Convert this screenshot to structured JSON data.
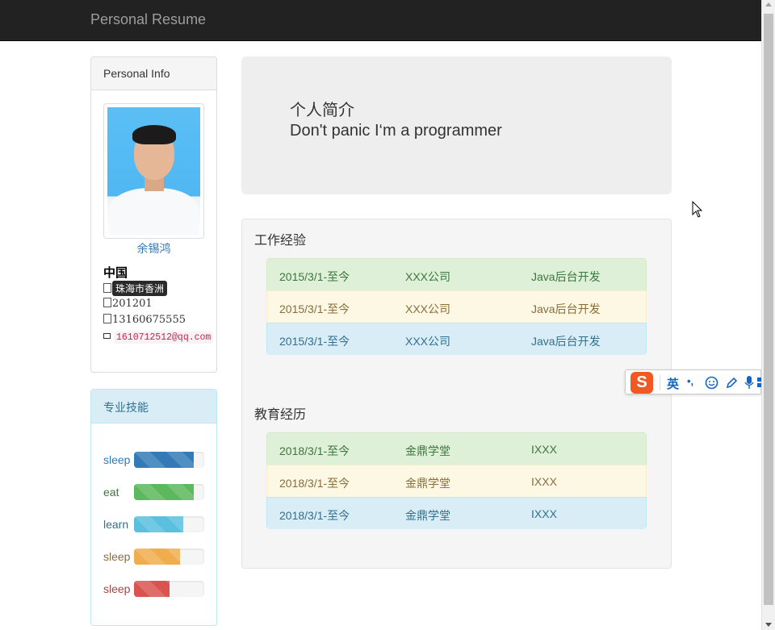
{
  "navbar": {
    "brand": "Personal Resume"
  },
  "personal": {
    "heading": "Personal Info",
    "name": "余锡鸿",
    "country": "中国",
    "address_tip": "珠海市香洲",
    "postal_code": "201201",
    "phone": "13160675555",
    "email": "1610712512@qq.com"
  },
  "skills": {
    "heading": "专业技能",
    "items": [
      {
        "label": "sleep",
        "level": 0.85,
        "color": "#337ab7",
        "label_color": "#337ab7"
      },
      {
        "label": "eat",
        "level": 0.85,
        "color": "#5cb85c",
        "label_color": "#3c763d"
      },
      {
        "label": "learn",
        "level": 0.7,
        "color": "#5bc0de",
        "label_color": "#31708f"
      },
      {
        "label": "sleep",
        "level": 0.65,
        "color": "#f0ad4e",
        "label_color": "#8a6d3b"
      },
      {
        "label": "sleep",
        "level": 0.5,
        "color": "#d9534f",
        "label_color": "#a94442"
      }
    ]
  },
  "intro": {
    "subtitle": "个人简介",
    "motto": "Don't panic I‘m a programmer"
  },
  "work": {
    "title": "工作经验",
    "rows": [
      {
        "date": "2015/3/1-至今",
        "org": "XXX公司",
        "role": "Java后台开发",
        "style": "success"
      },
      {
        "date": "2015/3/1-至今",
        "org": "XXX公司",
        "role": "Java后台开发",
        "style": "warning"
      },
      {
        "date": "2015/3/1-至今",
        "org": "XXX公司",
        "role": "Java后台开发",
        "style": "info"
      }
    ]
  },
  "education": {
    "title": "教育经历",
    "rows": [
      {
        "date": "2018/3/1-至今",
        "org": "金鼎学堂",
        "role": "IXXX",
        "style": "success"
      },
      {
        "date": "2018/3/1-至今",
        "org": "金鼎学堂",
        "role": "IXXX",
        "style": "warning"
      },
      {
        "date": "2018/3/1-至今",
        "org": "金鼎学堂",
        "role": "IXXX",
        "style": "info"
      }
    ]
  },
  "ime_toolbar": {
    "logo": "S",
    "mode": "英"
  }
}
